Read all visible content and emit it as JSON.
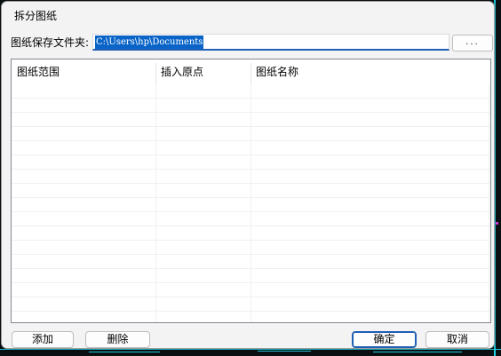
{
  "window": {
    "title": "拆分图纸"
  },
  "folder": {
    "label": "图纸保存文件夹:",
    "value": "C:\\Users\\hp\\Documents",
    "browse_label": "..."
  },
  "table": {
    "columns": [
      "图纸范围",
      "插入原点",
      "图纸名称"
    ],
    "rows": []
  },
  "buttons": {
    "add": "添加",
    "delete": "删除",
    "ok": "确定",
    "cancel": "取消"
  },
  "colors": {
    "selection": "#0a64c8",
    "focus_border": "#1f5fb5",
    "cad_background": "#0b1013",
    "cad_line": "#22d3e6"
  }
}
